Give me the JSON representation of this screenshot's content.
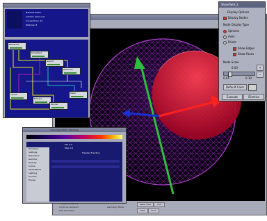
{
  "viewer": {
    "status": [
      "3 Isoperturbations",
      "Contours rendered",
      "Edit Geometry..."
    ],
    "mode_label": "Geometry Mode",
    "buttons": [
      "Reset View",
      "Quit",
      "Hide",
      "Show"
    ]
  },
  "network": {
    "top_lines": [
      "Network Editor",
      "Loaded: demo.net",
      "Connections: 12",
      "Modules: 8"
    ],
    "nodes": [
      "ReadField",
      "ShowField",
      "Isosurf",
      "GenColor",
      "Viewer",
      "Extract",
      "Render",
      "Mesh"
    ]
  },
  "colormap": {
    "header": [
      "Colormap Editor / Rainbow",
      "Min 0.0",
      "Max 1.0"
    ],
    "side": [
      "Hardware",
      "Settings",
      "Resolution",
      "Gamma",
      "Opacity",
      "Colors",
      "Alpha Blend",
      "Lighting",
      "Smooth",
      "Transp."
    ],
    "panel_label": "Transfer Function"
  },
  "options": {
    "title": "ShowField_1",
    "heading": "Display Options",
    "display_nodes": "Display Nodes",
    "type_heading": "Node Display Type",
    "types": [
      "Spheres",
      "Axes",
      "Points"
    ],
    "checks": [
      "Show Edges",
      "Show Faces"
    ],
    "scale_label": "Node Scale",
    "scale_value": "0.03",
    "scale_min": "0.01",
    "scale_max": "0.10",
    "default_color": "Default Color",
    "execute": "Execute",
    "dismiss": "Dismiss"
  }
}
